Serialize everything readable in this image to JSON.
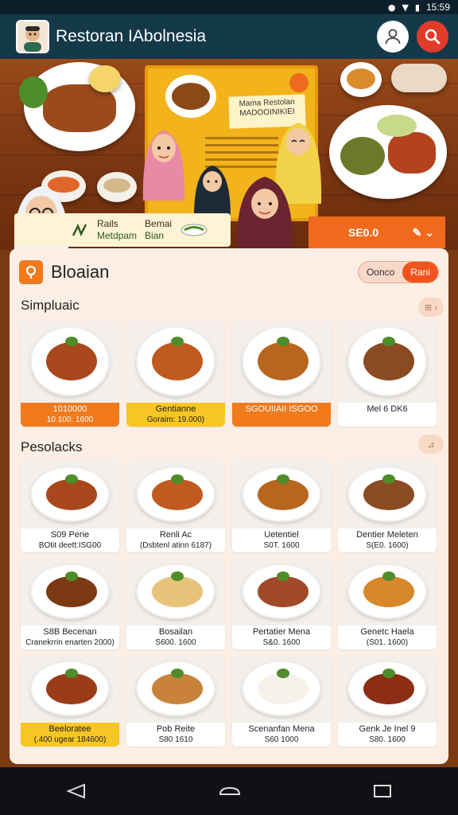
{
  "status_bar": {
    "time": "15:59",
    "icons": [
      "location-icon",
      "wifi-icon",
      "battery-icon"
    ]
  },
  "app_bar": {
    "title": "Restoran IAbolnesia",
    "profile_icon": "user-icon",
    "search_icon": "search-icon"
  },
  "hero": {
    "board_title": "Mama Restolan\nMADOOINIKIEI",
    "promo": {
      "line1a": "Rails",
      "line1b": "Metdpam",
      "line2a": "Bemai",
      "line2b": "Bian"
    },
    "price_banner": "SE0.0"
  },
  "panel": {
    "title": "Bloaian",
    "segments": [
      "Oonco",
      "Rani"
    ],
    "active_segment": 1
  },
  "section1": {
    "title": "Simpluaic",
    "items": [
      {
        "name": "1010000",
        "price": "10 100: 1600",
        "style": "orange"
      },
      {
        "name": "Gentianne",
        "price": "Goraim: 19.000)",
        "style": "yellow"
      },
      {
        "name": "SGOUIIAII ISGOO",
        "price": "",
        "style": "orange"
      },
      {
        "name": "Mel 6 DK6",
        "price": "",
        "style": "plain"
      }
    ]
  },
  "section2": {
    "title": "Pesolacks",
    "items": [
      {
        "name": "S09  Perie",
        "price": "BOtit deett:ISG00",
        "style": "plain"
      },
      {
        "name": "Renli Ac",
        "price": "(Dsbtenl atinn 6187)",
        "style": "plain"
      },
      {
        "name": "Uetentiel",
        "price": "S0T. 1600",
        "style": "plain"
      },
      {
        "name": "Dentier Meleten",
        "price": "S(E0. 1600)",
        "style": "plain"
      },
      {
        "name": "S8B  Becenan",
        "price": "Cranekrrin enarten 2000)",
        "style": "plain"
      },
      {
        "name": "Bosailan",
        "price": "S600. 1600",
        "style": "plain"
      },
      {
        "name": "Pertatier Mena",
        "price": "S&0. 1600",
        "style": "plain"
      },
      {
        "name": "Genetc Haela",
        "price": "(S01. 1600)",
        "style": "plain"
      },
      {
        "name": "Beeloratee",
        "price": "(.400 ugear 184600)",
        "style": "yellow"
      },
      {
        "name": "Pob Reite",
        "price": "S80 1610",
        "style": "plain"
      },
      {
        "name": "Scenanfan Mena",
        "price": "S60 1000",
        "style": "plain"
      },
      {
        "name": "Genk Je Inel 9",
        "price": "S80. 1600",
        "style": "plain"
      }
    ]
  },
  "colors": {
    "accent": "#f07a1c",
    "header": "#143a4a",
    "highlight": "#f8c623",
    "danger": "#e23b2a"
  }
}
